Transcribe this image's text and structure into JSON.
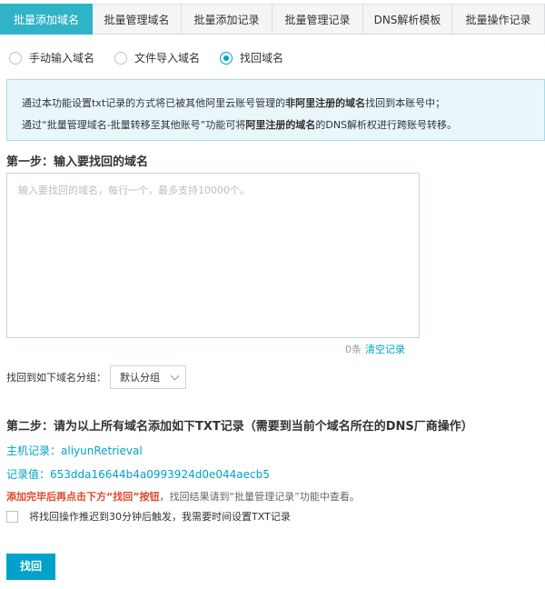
{
  "tabs": [
    {
      "label": "批量添加域名",
      "active": true
    },
    {
      "label": "批量管理域名",
      "active": false
    },
    {
      "label": "批量添加记录",
      "active": false
    },
    {
      "label": "批量管理记录",
      "active": false
    },
    {
      "label": "DNS解析模板",
      "active": false
    },
    {
      "label": "批量操作记录",
      "active": false
    }
  ],
  "radios": [
    {
      "label": "手动输入域名",
      "checked": false
    },
    {
      "label": "文件导入域名",
      "checked": false
    },
    {
      "label": "找回域名",
      "checked": true
    }
  ],
  "notice": {
    "line1_a": "通过本功能设置txt记录的方式将已被其他阿里云账号管理的",
    "line1_b": "非阿里注册的域名",
    "line1_c": "找回到本账号中；",
    "line2_a": "通过“批量管理域名-批量转移至其他账号”功能可将",
    "line2_b": "阿里注册的域名",
    "line2_c": "的DNS解析权进行跨账号转移。"
  },
  "step1": {
    "title": "第一步：输入要找回的域名",
    "textarea_value": "",
    "textarea_placeholder": "输入要找回的域名，每行一个，最多支持10000个。",
    "count": "0条",
    "clear_link": "清空记录"
  },
  "group": {
    "label": "找回到如下域名分组：",
    "selected": "默认分组"
  },
  "step2": {
    "title": "第二步：请为以上所有域名添加如下TXT记录（需要到当前个域名所在的DNS厂商操作）",
    "host_record": "主机记录：aliyunRetrieval",
    "record_value": "记录值：653dda16644b4a0993924d0e044aecb5",
    "warn_red": "添加完毕后再点击下方“找回”按钮",
    "warn_rest": "，找回结果请到“批量管理记录”功能中查看。",
    "checkbox_label": "将找回操作推迟到30分钟后触发，我需要时间设置TXT记录",
    "checkbox_checked": false
  },
  "submit_label": "找回",
  "colors": {
    "accent": "#00a2ca",
    "tab_active": "#2fb3c7",
    "warn": "#e0482b",
    "notice_bg": "#e9f7fb"
  }
}
